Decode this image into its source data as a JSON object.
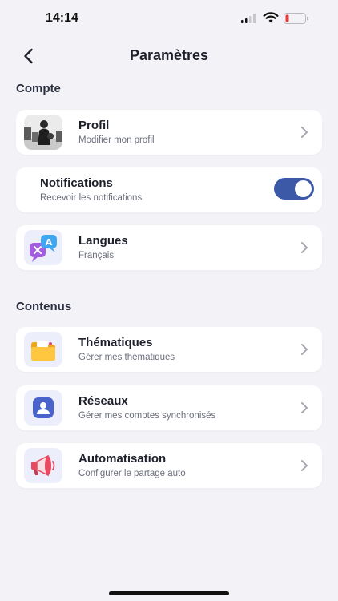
{
  "status_bar": {
    "time": "14:14"
  },
  "header": {
    "title": "Paramètres"
  },
  "sections": {
    "compte": {
      "title": "Compte",
      "profil": {
        "label": "Profil",
        "subtitle": "Modifier mon profil"
      },
      "notifications": {
        "label": "Notifications",
        "subtitle": "Recevoir les notifications",
        "enabled": true
      },
      "langues": {
        "label": "Langues",
        "subtitle": "Français"
      }
    },
    "contenus": {
      "title": "Contenus",
      "thematiques": {
        "label": "Thématiques",
        "subtitle": "Gérer mes thématiques"
      },
      "reseaux": {
        "label": "Réseaux",
        "subtitle": "Gérer mes comptes synchronisés"
      },
      "automatisation": {
        "label": "Automatisation",
        "subtitle": "Configurer le partage auto"
      }
    }
  },
  "icons": {
    "back": "chevron-left-icon",
    "chevron": "chevron-right-icon",
    "langues": "translate-icon",
    "thematiques": "folder-icon",
    "reseaux": "contact-card-icon",
    "automatisation": "megaphone-icon"
  },
  "colors": {
    "accent": "#3c59a7",
    "background": "#f3f3f7",
    "card": "#ffffff",
    "battery_low": "#e23b3b"
  }
}
